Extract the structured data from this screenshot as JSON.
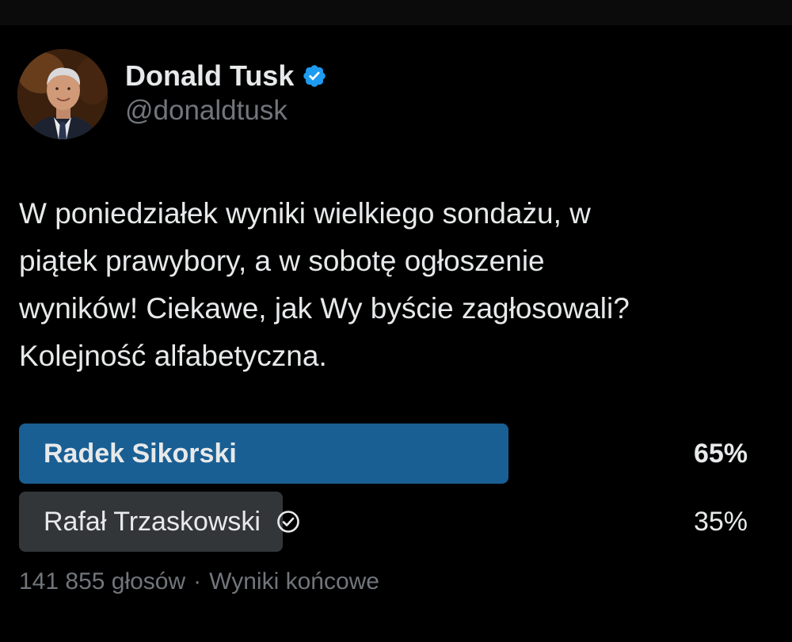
{
  "header": {
    "display_name": "Donald Tusk",
    "handle": "@donaldtusk",
    "verified": true,
    "verified_color": "#1d9bf0",
    "avatar_icon": "user-avatar-photo"
  },
  "tweet": {
    "text": "W poniedziałek wyniki wielkiego sondażu, w\npiątek prawybory, a w sobotę ogłoszenie\nwyników! Ciekawe, jak Wy byście zagłosowali?\nKolejność alfabetyczna."
  },
  "poll": {
    "options": [
      {
        "label": "Radek Sikorski",
        "percent_text": "65%",
        "share": 0.65,
        "leading": true,
        "bar_color": "#1a5f93"
      },
      {
        "label": "Rafał Trzaskowski",
        "percent_text": "35%",
        "share": 0.35,
        "user_vote": true,
        "bar_color": "#333639",
        "vote_icon": "check-circle-icon"
      }
    ],
    "votes": "141 855 głosów",
    "separator": "·",
    "status": "Wyniki końcowe"
  },
  "colors": {
    "background": "#000000",
    "text_primary": "#e7e9ea",
    "text_secondary": "#71767b"
  }
}
